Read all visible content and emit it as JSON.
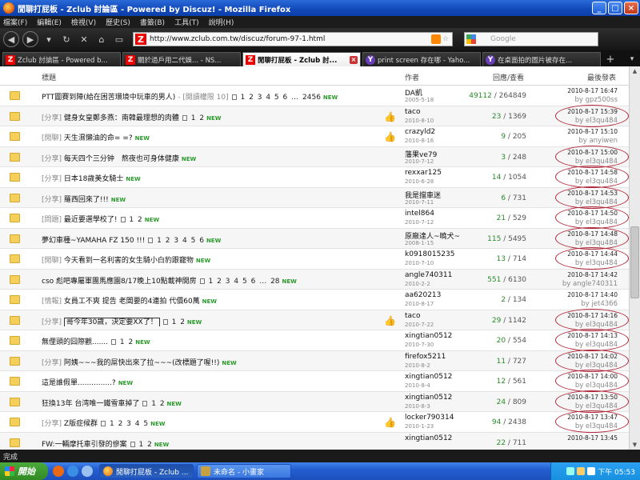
{
  "window": {
    "title": "閒聊打屁板 - Zclub 討論區 - Powered by Discuz! - Mozilla Firefox"
  },
  "menu": [
    "檔案(F)",
    "編輯(E)",
    "檢視(V)",
    "歷史(S)",
    "書籤(B)",
    "工具(T)",
    "說明(H)"
  ],
  "nav": {
    "url": "http://www.zclub.com.tw/discuz/forum-97-1.html",
    "search_placeholder": "Google"
  },
  "tabs": [
    {
      "label": "Zclub 討論區 - Powered b...",
      "fav": "Z"
    },
    {
      "label": "關於過戶用二代娛... - NS...",
      "fav": "Z"
    },
    {
      "label": "閒聊打屁板 - Zclub 討...",
      "fav": "Z",
      "active": true
    },
    {
      "label": "print screen 存在哪 - Yaho...",
      "fav": "Y"
    },
    {
      "label": "在桌面拍的圖片被存在...",
      "fav": "Y"
    }
  ],
  "header": {
    "title": "標題",
    "author": "作者",
    "stats": "回應/查看",
    "last": "最後發表"
  },
  "rows": [
    {
      "cat": "",
      "title": "PTT圖賽到陣(給在困苦環境中玩車的男人)",
      "extra": " - [閱讀權限 10]",
      "pages": [
        "1",
        "2",
        "3",
        "4",
        "5",
        "6",
        "…",
        "2456"
      ],
      "new": true,
      "thumb": false,
      "author": "DA凱",
      "adate": "2005-5-18",
      "replies": "49112",
      "views": "264849",
      "last": "2010-8-17 16:47",
      "lastby": "by gpz500ss",
      "circle": false
    },
    {
      "cat": "[分享]",
      "title": "健身女皇鄭多燕：南韓最理想的肉體",
      "extra": "",
      "pages": [
        "1",
        "2"
      ],
      "new": true,
      "thumb": true,
      "author": "taco",
      "adate": "2010-8-10",
      "replies": "23",
      "views": "1369",
      "last": "2010-8-17 15:39",
      "lastby": "by el3qu484",
      "circle": true
    },
    {
      "cat": "[閒聊]",
      "title": "天生濕懶油的命= =?",
      "extra": "",
      "pages": [],
      "new": true,
      "thumb": true,
      "author": "crazyld2",
      "adate": "2010-8-16",
      "replies": "9",
      "views": "205",
      "last": "2010-8-17 15:10",
      "lastby": "by anyiwen",
      "circle": false
    },
    {
      "cat": "[分享]",
      "title": "每天四个三分钟　熬夜也可身体健康",
      "extra": "",
      "pages": [],
      "new": true,
      "thumb": false,
      "author": "藩果ve79",
      "adate": "2010-7-12",
      "replies": "3",
      "views": "248",
      "last": "2010-8-17 15:00",
      "lastby": "by el3qu484",
      "circle": true
    },
    {
      "cat": "[分享]",
      "title": "日本18歲美女騎士",
      "extra": "",
      "pages": [],
      "new": true,
      "thumb": false,
      "author": "rexxar125",
      "adate": "2010-6-28",
      "replies": "14",
      "views": "1054",
      "last": "2010-8-17 14:58",
      "lastby": "by el3qu484",
      "circle": true
    },
    {
      "cat": "[分享]",
      "title": "羅西回來了!!!",
      "extra": "",
      "pages": [],
      "new": true,
      "thumb": false,
      "author": "我是擋車迷",
      "adate": "2010-7-11",
      "replies": "6",
      "views": "731",
      "last": "2010-8-17 14:53",
      "lastby": "by el3qu484",
      "circle": true
    },
    {
      "cat": "[問題]",
      "title": "最近要選學校了!",
      "extra": "",
      "pages": [
        "1",
        "2"
      ],
      "new": true,
      "thumb": false,
      "author": "intel864",
      "adate": "2010-7-12",
      "replies": "21",
      "views": "529",
      "last": "2010-8-17 14:50",
      "lastby": "by el3qu484",
      "circle": true
    },
    {
      "cat": "",
      "title": "夢幻車種~YAMAHA FZ 150 !!!",
      "extra": "",
      "pages": [
        "1",
        "2",
        "3",
        "4",
        "5",
        "6"
      ],
      "new": true,
      "thumb": false,
      "author": "原廠達人~曉犬~",
      "adate": "2008-1-15",
      "replies": "115",
      "views": "5495",
      "last": "2010-8-17 14:48",
      "lastby": "by el3qu484",
      "circle": true
    },
    {
      "cat": "[閒聊]",
      "title": "今天看到一名利害的女生騎小白豹跟寵物",
      "extra": "",
      "pages": [],
      "new": true,
      "thumb": false,
      "author": "k0918015235",
      "adate": "2010-7-10",
      "replies": "13",
      "views": "714",
      "last": "2010-8-17 14:44",
      "lastby": "by el3qu484",
      "circle": true
    },
    {
      "cat": "",
      "title": "cso 彪吧專屬軍團馬應園8/17晚上10點載神開房",
      "extra": "",
      "pages": [
        "1",
        "2",
        "3",
        "4",
        "5",
        "6",
        "…",
        "28"
      ],
      "new": true,
      "thumb": false,
      "author": "angle740311",
      "adate": "2010-2-2",
      "replies": "551",
      "views": "6130",
      "last": "2010-8-17 14:42",
      "lastby": "by angle740311",
      "circle": false
    },
    {
      "cat": "[情報]",
      "title": "女員工不爽 提告 老闆要的4連拍 代價60萬",
      "extra": "",
      "pages": [],
      "new": true,
      "thumb": false,
      "author": "aa620213",
      "adate": "2010-8-17",
      "replies": "2",
      "views": "134",
      "last": "2010-8-17 14:40",
      "lastby": "by jet4366",
      "circle": false
    },
    {
      "cat": "[分享]",
      "title": "哥今年30歲，決定要XX了！",
      "extra": "",
      "pages": [
        "1",
        "2"
      ],
      "new": true,
      "thumb": true,
      "boxed": true,
      "author": "taco",
      "adate": "2010-7-22",
      "replies": "29",
      "views": "1142",
      "last": "2010-8-17 14:16",
      "lastby": "by el3qu484",
      "circle": true
    },
    {
      "cat": "",
      "title": "無俚頭的囧際觀.......",
      "extra": "",
      "pages": [
        "1",
        "2"
      ],
      "new": true,
      "thumb": false,
      "author": "xingtian0512",
      "adate": "2010-7-30",
      "replies": "20",
      "views": "554",
      "last": "2010-8-17 14:13",
      "lastby": "by el3qu484",
      "circle": true
    },
    {
      "cat": "[分享]",
      "title": "阿姨~~~我的屌快出來了拉~~~(改標題了喔!!)",
      "extra": "",
      "pages": [],
      "new": true,
      "thumb": false,
      "author": "firefox5211",
      "adate": "2010-8-2",
      "replies": "11",
      "views": "727",
      "last": "2010-8-17 14:02",
      "lastby": "by el3qu484",
      "circle": true
    },
    {
      "cat": "",
      "title": "這是誰假單...............?",
      "extra": "",
      "pages": [],
      "new": true,
      "thumb": false,
      "author": "xingtian0512",
      "adate": "2010-8-4",
      "replies": "12",
      "views": "561",
      "last": "2010-8-17 14:00",
      "lastby": "by el3qu484",
      "circle": true
    },
    {
      "cat": "",
      "title": "狂換13年 台湾唯一鐵雪車掉了",
      "extra": "",
      "pages": [
        "1",
        "2"
      ],
      "new": true,
      "thumb": false,
      "author": "xingtian0512",
      "adate": "2010-8-3",
      "replies": "24",
      "views": "809",
      "last": "2010-8-17 13:50",
      "lastby": "by el3qu484",
      "circle": true
    },
    {
      "cat": "[分享]",
      "title": "Z版症候群",
      "extra": "",
      "pages": [
        "1",
        "2",
        "3",
        "4",
        "5"
      ],
      "new": true,
      "thumb": true,
      "author": "locker790314",
      "adate": "2010-1-23",
      "replies": "94",
      "views": "2438",
      "last": "2010-8-17 13:47",
      "lastby": "by el3qu484",
      "circle": true
    },
    {
      "cat": "",
      "title": "FW:一輛摩托車引發的慘案",
      "extra": "",
      "pages": [
        "1",
        "2"
      ],
      "new": true,
      "thumb": false,
      "author": "xingtian0512",
      "adate": "",
      "replies": "22",
      "views": "711",
      "last": "2010-8-17 13:45",
      "lastby": "",
      "circle": false
    }
  ],
  "new_label": "NEW",
  "status": "完成",
  "taskbar": {
    "start": "開始",
    "items": [
      "閒聊打屁板 - Zclub ...",
      "未命名 - 小畫家"
    ],
    "clock": "下午 05:53"
  }
}
